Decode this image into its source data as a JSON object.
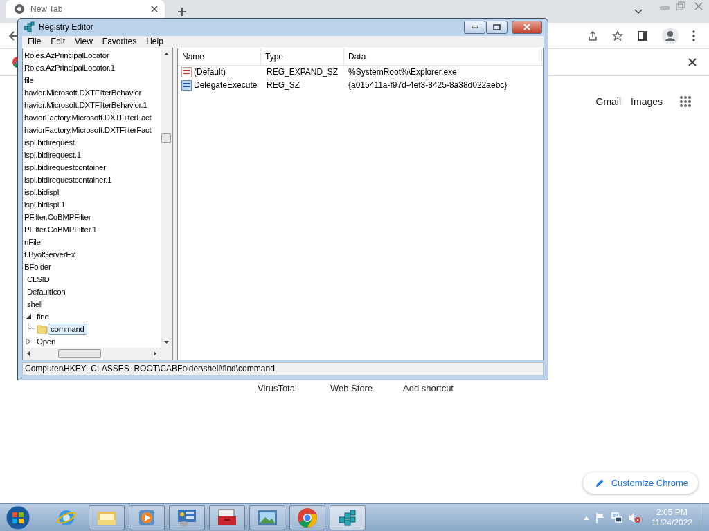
{
  "browser": {
    "tab": {
      "title": "New Tab"
    },
    "top_links": [
      "Gmail",
      "Images"
    ],
    "shortcuts": [
      "VirusTotal",
      "Web Store",
      "Add shortcut"
    ],
    "customize_button": "Customize Chrome"
  },
  "regedit": {
    "title": "Registry Editor",
    "menu": [
      "File",
      "Edit",
      "View",
      "Favorites",
      "Help"
    ],
    "tree": [
      {
        "label": "Roles.AzPrincipalLocator",
        "selected": false
      },
      {
        "label": "Roles.AzPrincipalLocator.1",
        "selected": false
      },
      {
        "label": "file",
        "selected": false
      },
      {
        "label": "havior.Microsoft.DXTFilterBehavior",
        "selected": false
      },
      {
        "label": "havior.Microsoft.DXTFilterBehavior.1",
        "selected": false
      },
      {
        "label": "haviorFactory.Microsoft.DXTFilterFact",
        "selected": false
      },
      {
        "label": "haviorFactory.Microsoft.DXTFilterFact",
        "selected": false
      },
      {
        "label": "ispl.bidirequest",
        "selected": false
      },
      {
        "label": "ispl.bidirequest.1",
        "selected": false
      },
      {
        "label": "ispl.bidirequestcontainer",
        "selected": false
      },
      {
        "label": "ispl.bidirequestcontainer.1",
        "selected": false
      },
      {
        "label": "ispl.bidispl",
        "selected": false
      },
      {
        "label": "ispl.bidispl.1",
        "selected": false
      },
      {
        "label": "PFilter.CoBMPFilter",
        "selected": false
      },
      {
        "label": "PFilter.CoBMPFilter.1",
        "selected": false
      },
      {
        "label": "nFile",
        "selected": false
      },
      {
        "label": "t.ByotServerEx",
        "selected": false
      },
      {
        "label": "BFolder",
        "selected": false,
        "children": [
          {
            "label": "CLSID",
            "selected": false
          },
          {
            "label": "DefaultIcon",
            "selected": false
          },
          {
            "label": "shell",
            "selected": false,
            "children": [
              {
                "label": "find",
                "selected": false,
                "expanded": true,
                "children": [
                  {
                    "label": "command",
                    "selected": true
                  }
                ]
              },
              {
                "label": "Open",
                "selected": false,
                "expanded": false
              }
            ]
          }
        ]
      }
    ],
    "columns": [
      "Name",
      "Type",
      "Data"
    ],
    "rows": [
      {
        "kind": "expand_string",
        "name": "(Default)",
        "type": "REG_EXPAND_SZ",
        "data": "%SystemRoot%\\Explorer.exe"
      },
      {
        "kind": "string",
        "name": "DelegateExecute",
        "type": "REG_SZ",
        "data": "{a015411a-f97d-4ef3-8425-8a38d022aebc}"
      }
    ],
    "status": "Computer\\HKEY_CLASSES_ROOT\\CABFolder\\shell\\find\\command"
  },
  "taskbar": {
    "apps": [
      {
        "kind": "ie",
        "running": false,
        "selected": false
      },
      {
        "kind": "explorer",
        "running": true,
        "selected": false
      },
      {
        "kind": "media",
        "running": true,
        "selected": false
      },
      {
        "kind": "control",
        "running": true,
        "selected": false
      },
      {
        "kind": "toolbox",
        "running": true,
        "selected": false
      },
      {
        "kind": "photo",
        "running": true,
        "selected": false
      },
      {
        "kind": "chrome",
        "running": true,
        "selected": false
      },
      {
        "kind": "regedit",
        "running": true,
        "selected": true
      }
    ],
    "clock": {
      "time": "2:05 PM",
      "date": "11/24/2022"
    }
  }
}
